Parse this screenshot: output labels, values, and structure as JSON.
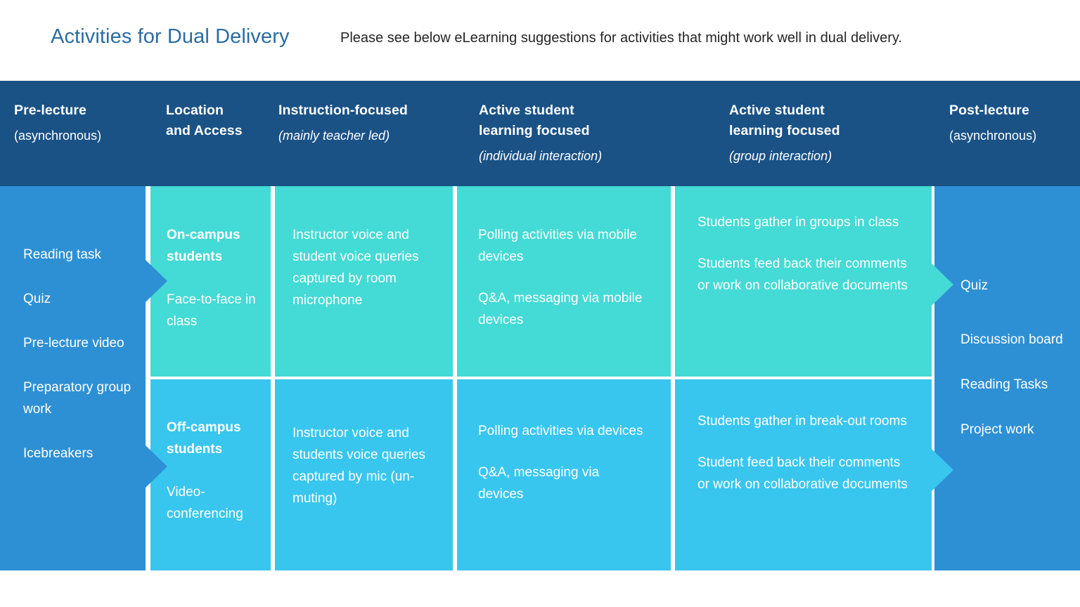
{
  "header": {
    "title": "Activities for Dual Delivery",
    "subtitle": "Please see below eLearning suggestions for activities that might work well in dual delivery."
  },
  "colors": {
    "title_blue": "#2b6ca3",
    "header_bar": "#1a5286",
    "column_blue": "#2e90d4",
    "row_teal": "#44dad5",
    "row_cyan": "#38c6ef",
    "gutter": "#ffffff"
  },
  "columns": [
    {
      "id": "pre-lecture",
      "main": "Pre-lecture",
      "sub": "(asynchronous)",
      "sub_italic": false
    },
    {
      "id": "location-and-access",
      "main": "Location\nand Access",
      "sub": "",
      "sub_italic": false
    },
    {
      "id": "instruction-focused",
      "main": "Instruction-focused",
      "sub": "(mainly teacher led)",
      "sub_italic": true
    },
    {
      "id": "active-individual",
      "main": "Active student\nlearning focused",
      "sub": "(individual interaction)",
      "sub_italic": true
    },
    {
      "id": "active-group",
      "main": "Active student\nlearning focused",
      "sub": "(group interaction)",
      "sub_italic": true
    },
    {
      "id": "post-lecture",
      "main": "Post-lecture",
      "sub": "(asynchronous)",
      "sub_italic": false
    }
  ],
  "pre_lecture_items": [
    "Reading task",
    "Quiz",
    "Pre-lecture video",
    "Preparatory group work",
    "Icebreakers"
  ],
  "post_lecture_items": [
    "Quiz",
    "Discussion board",
    "Reading Tasks",
    "Project work"
  ],
  "rows": [
    {
      "id": "on-campus",
      "location_title": "On-campus students",
      "location_detail": "Face-to-face in class",
      "instruction": "Instructor voice and student voice queries captured by room microphone",
      "individual": [
        "Polling activities via mobile devices",
        "Q&A, messaging via mobile devices"
      ],
      "group": [
        "Students gather in groups in class",
        "Students feed back their comments or work on collaborative documents"
      ]
    },
    {
      "id": "off-campus",
      "location_title": "Off-campus students",
      "location_detail": "Video-conferencing",
      "instruction": "Instructor voice and students voice queries captured by mic (un-muting)",
      "individual": [
        "Polling activities via devices",
        "Q&A, messaging via devices"
      ],
      "group": [
        "Students gather in break-out rooms",
        "Student feed back their comments or work on collaborative documents"
      ]
    }
  ]
}
